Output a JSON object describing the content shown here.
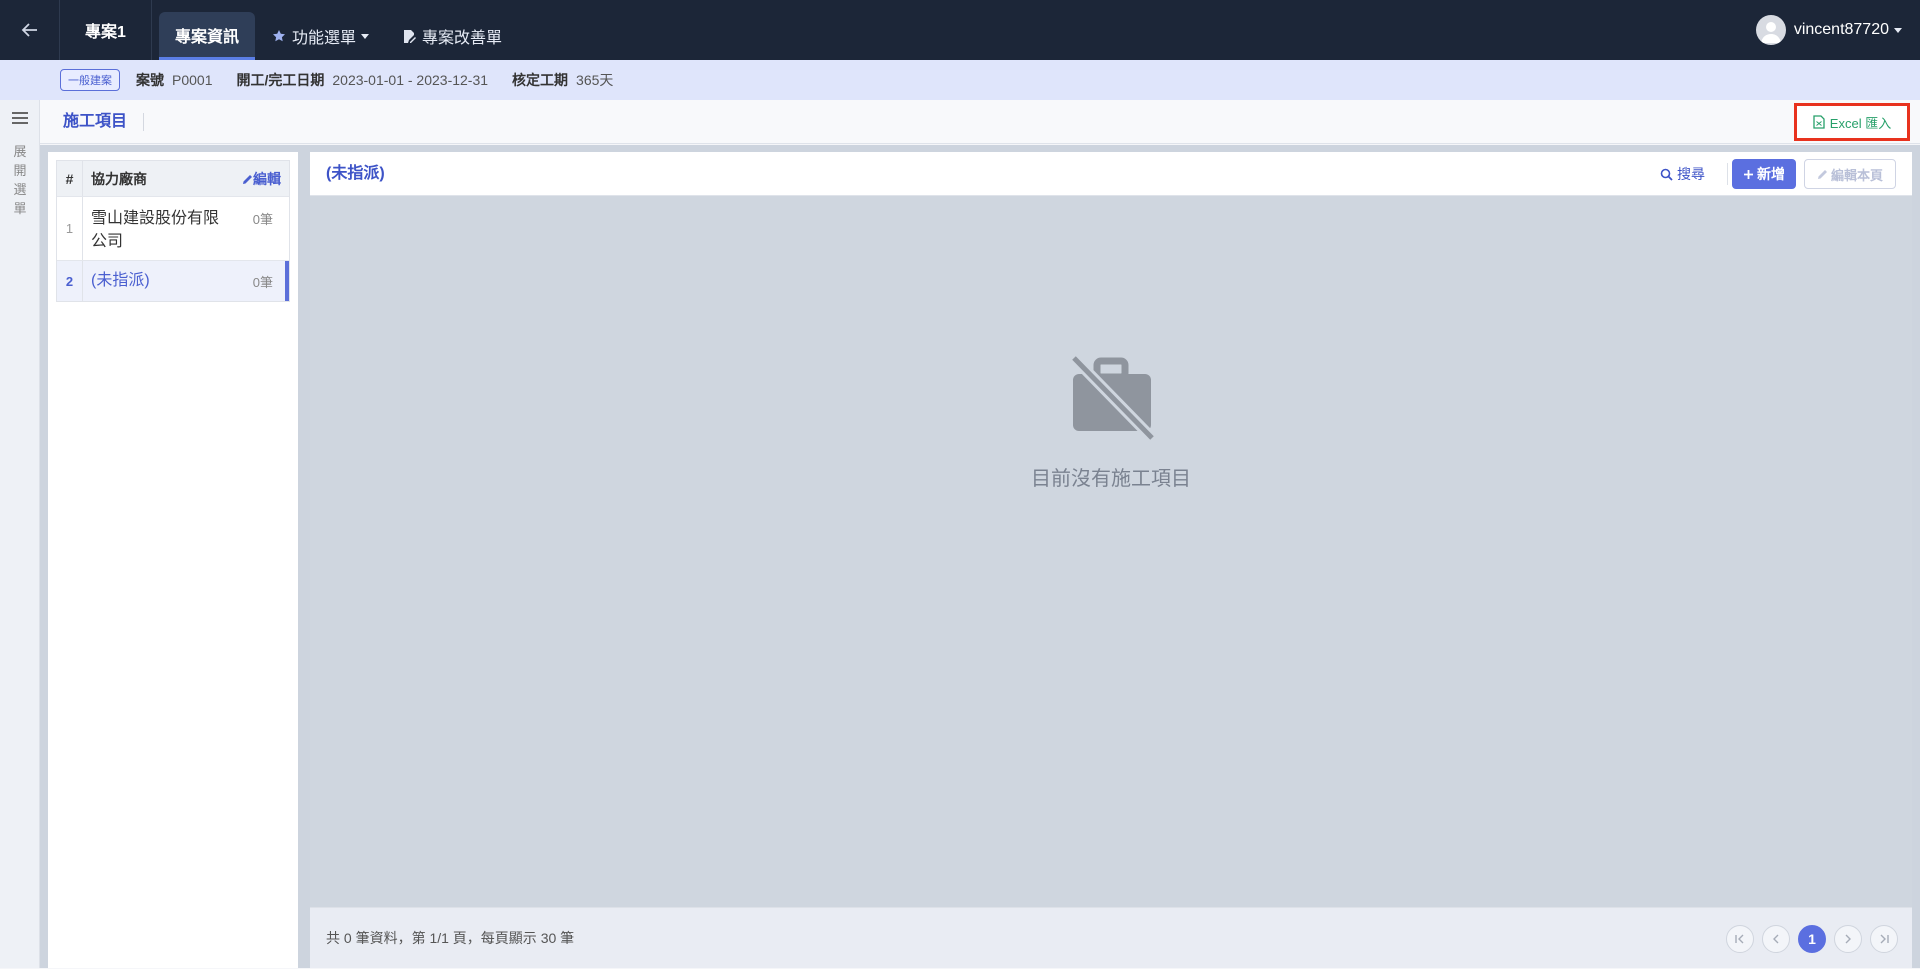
{
  "nav": {
    "project_name": "專案1",
    "tabs": [
      {
        "label": "專案資訊"
      },
      {
        "label": "功能選單"
      },
      {
        "label": "專案改善單"
      }
    ],
    "username": "vincent87720"
  },
  "info": {
    "badge": "一般建案",
    "case_no_label": "案號",
    "case_no": "P0001",
    "date_label": "開工/完工日期",
    "date": "2023-01-01 - 2023-12-31",
    "duration_label": "核定工期",
    "duration": "365天"
  },
  "sidebar": {
    "expand_text": "展開選單"
  },
  "section": {
    "title": "施工項目",
    "excel_label": "Excel 匯入"
  },
  "vendors": {
    "header_num": "#",
    "header_name": "協力廠商",
    "edit_label": "編輯",
    "rows": [
      {
        "num": "1",
        "name": "雪山建設股份有限公司",
        "count": "0筆"
      },
      {
        "num": "2",
        "name": "(未指派)",
        "count": "0筆"
      }
    ]
  },
  "main": {
    "title": "(未指派)",
    "search_label": "搜尋",
    "add_label": "新增",
    "edit_page_label": "編輯本頁",
    "empty_text": "目前沒有施工項目",
    "footer_text": "共 0 筆資料，第 1/1 頁，每頁顯示 30 筆",
    "current_page": "1"
  },
  "colors": {
    "navbar": "#1c2638",
    "accent": "#5b6fe0",
    "excel_green": "#27a06a",
    "highlight_red": "#e8321e"
  }
}
